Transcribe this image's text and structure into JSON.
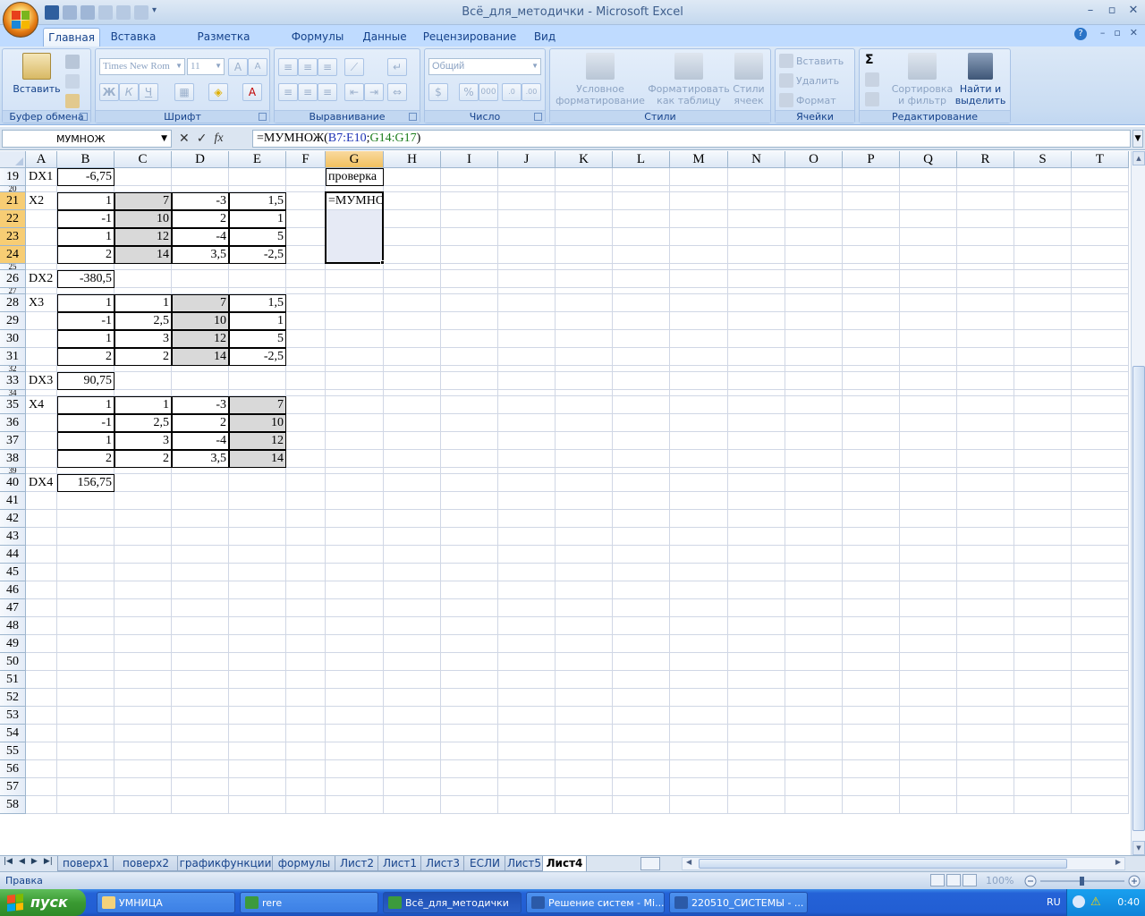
{
  "window": {
    "title": "Всё_для_методички - Microsoft Excel"
  },
  "ribbon_tabs": [
    "Главная",
    "Вставка",
    "Разметка страницы",
    "Формулы",
    "Данные",
    "Рецензирование",
    "Вид"
  ],
  "ribbon": {
    "clipboard": {
      "label": "Буфер обмена",
      "paste": "Вставить"
    },
    "font": {
      "label": "Шрифт",
      "font_name": "Times New Rom",
      "font_size": "11",
      "bold": "Ж",
      "italic": "К",
      "underline": "Ч"
    },
    "alignment": {
      "label": "Выравнивание"
    },
    "number": {
      "label": "Число",
      "format": "Общий"
    },
    "styles": {
      "label": "Стили",
      "conditional_l1": "Условное",
      "conditional_l2": "форматирование",
      "format_table_l1": "Форматировать",
      "format_table_l2": "как таблицу",
      "cell_styles_l1": "Стили",
      "cell_styles_l2": "ячеек"
    },
    "cells": {
      "label": "Ячейки",
      "insert": "Вставить",
      "delete": "Удалить",
      "format": "Формат"
    },
    "editing": {
      "label": "Редактирование",
      "sort_l1": "Сортировка",
      "sort_l2": "и фильтр",
      "find_l1": "Найти и",
      "find_l2": "выделить"
    }
  },
  "formula_bar": {
    "name_box": "МУМНОЖ",
    "formula_prefix": "=МУМНОЖ(",
    "ref1": "B7:E10",
    "sep": ";",
    "ref2": "G14:G17",
    "suffix": ")"
  },
  "columns": [
    "A",
    "B",
    "C",
    "D",
    "E",
    "F",
    "G",
    "H",
    "I",
    "J",
    "K",
    "L",
    "M",
    "N",
    "O",
    "P",
    "Q",
    "R",
    "S",
    "T"
  ],
  "rows": [
    "19",
    "20",
    "21",
    "22",
    "23",
    "24",
    "25",
    "26",
    "27",
    "28",
    "29",
    "30",
    "31",
    "32",
    "33",
    "34",
    "35",
    "36",
    "37",
    "38",
    "39",
    "40",
    "41",
    "42",
    "43",
    "44",
    "45",
    "46",
    "47",
    "48",
    "49",
    "50",
    "51",
    "52",
    "53",
    "54",
    "55",
    "56",
    "57",
    "58"
  ],
  "cells": {
    "A19": "DX1",
    "B19": "-6,75",
    "G19": "проверка",
    "A21": "X2",
    "B21": "1",
    "C21": "7",
    "D21": "-3",
    "E21": "1,5",
    "G21": "=МУМНОЖ",
    "B22": "-1",
    "C22": "10",
    "D22": "2",
    "E22": "1",
    "B23": "1",
    "C23": "12",
    "D23": "-4",
    "E23": "5",
    "B24": "2",
    "C24": "14",
    "D24": "3,5",
    "E24": "-2,5",
    "A26": "DX2",
    "B26": "-380,5",
    "A28": "X3",
    "B28": "1",
    "C28": "1",
    "D28": "7",
    "E28": "1,5",
    "B29": "-1",
    "C29": "2,5",
    "D29": "10",
    "E29": "1",
    "B30": "1",
    "C30": "3",
    "D30": "12",
    "E30": "5",
    "B31": "2",
    "C31": "2",
    "D31": "14",
    "E31": "-2,5",
    "A33": "DX3",
    "B33": "90,75",
    "A35": "X4",
    "B35": "1",
    "C35": "1",
    "D35": "-3",
    "E35": "7",
    "B36": "-1",
    "C36": "2,5",
    "D36": "2",
    "E36": "10",
    "B37": "1",
    "C37": "3",
    "D37": "-4",
    "E37": "12",
    "B38": "2",
    "C38": "2",
    "D38": "3,5",
    "E38": "14",
    "A40": "DX4",
    "B40": "156,75"
  },
  "sheet_tabs": [
    "поверх1",
    "поверх2",
    "графикфункции",
    "формулы",
    "Лист2",
    "Лист1",
    "Лист3",
    "ЕСЛИ",
    "Лист5",
    "Лист4"
  ],
  "active_sheet": "Лист4",
  "status": {
    "mode": "Правка",
    "zoom": "100%"
  },
  "taskbar": {
    "start": "пуск",
    "tasks": [
      "УМНИЦА",
      "rere",
      "Всё_для_методички",
      "Решение систем - Mi...",
      "220510_СИСТЕМЫ - ..."
    ],
    "lang": "RU",
    "clock": "0:40"
  },
  "colors": {
    "accent": "#15428b",
    "gray_cell": "#d9d9d9",
    "selected_header": "#f7cd74"
  }
}
